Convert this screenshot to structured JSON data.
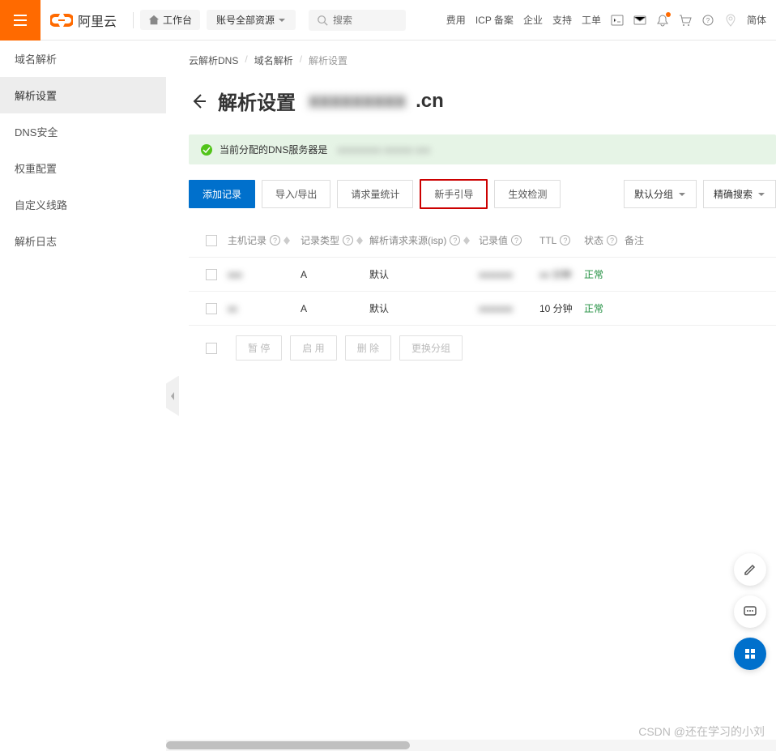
{
  "header": {
    "logo_text": "阿里云",
    "workspace": "工作台",
    "resource_selector": "账号全部资源",
    "search_placeholder": "搜索",
    "links": [
      "费用",
      "ICP 备案",
      "企业",
      "支持",
      "工单"
    ],
    "lang": "简体"
  },
  "sidebar": {
    "items": [
      {
        "label": "域名解析"
      },
      {
        "label": "解析设置"
      },
      {
        "label": "DNS安全"
      },
      {
        "label": "权重配置"
      },
      {
        "label": "自定义线路"
      },
      {
        "label": "解析日志"
      }
    ],
    "active_index": 1
  },
  "breadcrumb": {
    "items": [
      "云解析DNS",
      "域名解析",
      "解析设置"
    ]
  },
  "page": {
    "title_prefix": "解析设置",
    "title_blurred": "xxxxxxxxx",
    "title_suffix": ".cn"
  },
  "alert": {
    "text": "当前分配的DNS服务器是",
    "blurred": "xxxxxxxxx xxxxxx xxx"
  },
  "toolbar": {
    "add_record": "添加记录",
    "import_export": "导入/导出",
    "request_stats": "请求量统计",
    "newbie_guide": "新手引导",
    "validity_check": "生效检测",
    "default_group": "默认分组",
    "exact_search": "精确搜索"
  },
  "table": {
    "headers": {
      "host": "主机记录",
      "type": "记录类型",
      "isp": "解析请求来源(isp)",
      "value": "记录值",
      "ttl": "TTL",
      "status": "状态",
      "note": "备注"
    },
    "rows": [
      {
        "host": "xxx",
        "type": "A",
        "isp": "默认",
        "value": "xxxxxxx",
        "ttl": "xx 分钟",
        "status": "正常"
      },
      {
        "host": "xx",
        "type": "A",
        "isp": "默认",
        "value": "xxxxxxx",
        "ttl": "10 分钟",
        "status": "正常"
      }
    ],
    "bulk_actions": {
      "pause": "暂 停",
      "enable": "启 用",
      "delete": "删 除",
      "change_group": "更换分组"
    }
  },
  "watermark": "CSDN @还在学习的小刘"
}
